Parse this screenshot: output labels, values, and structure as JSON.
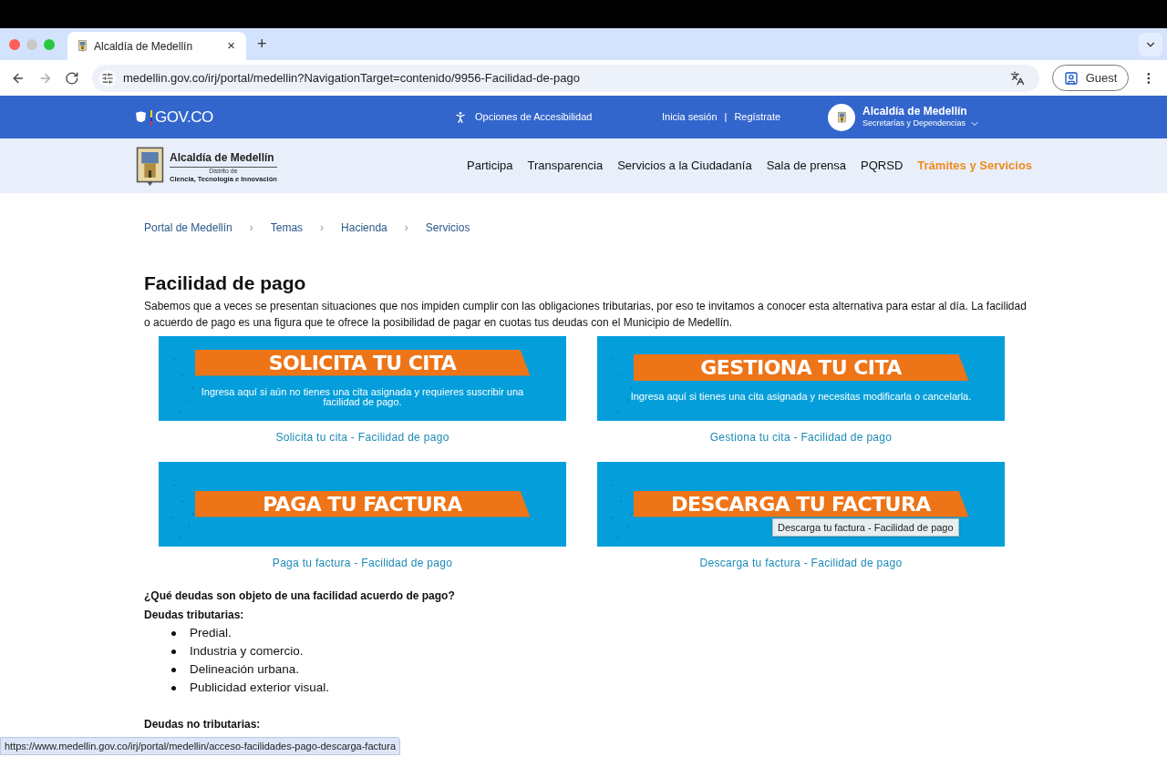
{
  "browser": {
    "tab": {
      "title": "Alcaldía de Medellín",
      "close": "×",
      "selected": true
    },
    "new_tab": "+",
    "url": "medellin.gov.co/irj/portal/medellin?NavigationTarget=contenido/9956-Facilidad-de-pago",
    "profile": "Guest"
  },
  "gov_bar": {
    "logo": "GOV.CO",
    "accessibility": "Opciones de Accesibilidad",
    "login": "Inicia sesión",
    "divider": "|",
    "register": "Regístrate",
    "entity_title": "Alcaldía de Medellín",
    "entity_subtitle": "Secretarías y Dependencias"
  },
  "site_header": {
    "logo_title": "Alcaldía de Medellín",
    "logo_line1": "Distrito de",
    "logo_line2": "Ciencia, Tecnología e Innovación",
    "nav": [
      {
        "label": "Participa",
        "selected": false
      },
      {
        "label": "Transparencia",
        "selected": false
      },
      {
        "label": "Servicios a la Ciudadanía",
        "selected": false
      },
      {
        "label": "Sala de prensa",
        "selected": false
      },
      {
        "label": "PQRSD",
        "selected": false
      },
      {
        "label": "Trámites y Servicios",
        "selected": true
      }
    ]
  },
  "breadcrumb": {
    "separator": "›",
    "items": [
      "Portal de Medellín",
      "Temas",
      "Hacienda",
      "Servicios"
    ]
  },
  "article": {
    "title": "Facilidad de pago",
    "intro": "Sabemos que a veces se presentan situaciones que nos impiden cumplir con las obligaciones tributarias, por eso te invitamos a conocer esta alternativa para estar al día. La facilidad o acuerdo de pago es una figura que te ofrece la posibilidad de pagar en cuotas tus deudas con el Municipio de Medellín.",
    "banners": [
      {
        "title": "SOLICITA TU CITA",
        "subtitle": "Ingresa aquí si aún no tienes una cita asignada y requieres suscribir una facilidad de pago.",
        "caption": "Solicita tu cita - Facilidad de pago"
      },
      {
        "title": "GESTIONA TU CITA",
        "subtitle": "Ingresa aquí si tienes una cita asignada y necesitas modificarla o cancelarla.",
        "caption": "Gestiona tu cita - Facilidad de pago"
      },
      {
        "title": "PAGA TU FACTURA",
        "caption": "Paga tu factura - Facilidad de pago"
      },
      {
        "title": "DESCARGA TU FACTURA",
        "caption": "Descarga tu factura - Facilidad de pago",
        "tooltip": "Descarga tu factura - Facilidad de pago"
      }
    ],
    "question": "¿Qué deudas son objeto de una facilidad acuerdo de pago?",
    "sections": [
      {
        "heading": "Deudas tributarias:",
        "items": [
          "Predial.",
          "Industria y comercio.",
          "Delineación urbana.",
          "Publicidad exterior visual."
        ]
      },
      {
        "heading": "Deudas no tributarias:"
      }
    ]
  },
  "status_url": "https://www.medellin.gov.co/irj/portal/medellin/acceso-facilidades-pago-descarga-factura"
}
